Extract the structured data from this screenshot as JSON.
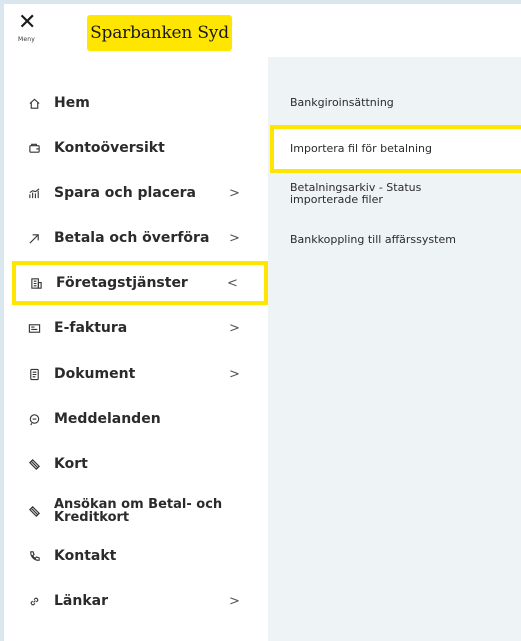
{
  "header": {
    "menu_label": "Meny",
    "brand": "Sparbanken Syd",
    "brand_color": "#ffe600"
  },
  "nav": {
    "items": [
      {
        "label": "Hem",
        "icon": "home-icon",
        "chevron": ""
      },
      {
        "label": "Kontoöversikt",
        "icon": "wallet-icon",
        "chevron": ""
      },
      {
        "label": "Spara och placera",
        "icon": "chart-icon",
        "chevron": ">"
      },
      {
        "label": "Betala och överföra",
        "icon": "transfer-icon",
        "chevron": ">"
      },
      {
        "label": "Företagstjänster",
        "icon": "building-icon",
        "chevron": "<"
      },
      {
        "label": "E-faktura",
        "icon": "invoice-icon",
        "chevron": ">"
      },
      {
        "label": "Dokument",
        "icon": "document-icon",
        "chevron": ">"
      },
      {
        "label": "Meddelanden",
        "icon": "message-icon",
        "chevron": ""
      },
      {
        "label": "Kort",
        "icon": "card-icon",
        "chevron": ""
      },
      {
        "label": "Ansökan om Betal- och Kreditkort",
        "icon": "card-icon",
        "chevron": ""
      },
      {
        "label": "Kontakt",
        "icon": "phone-icon",
        "chevron": ""
      },
      {
        "label": "Länkar",
        "icon": "link-icon",
        "chevron": ">"
      }
    ]
  },
  "submenu": {
    "items": [
      {
        "label": "Bankgiroinsättning"
      },
      {
        "label": "Importera fil för betalning"
      },
      {
        "label": "Betalningsarkiv - Status importerade filer"
      },
      {
        "label": "Bankkoppling till affärssystem"
      }
    ]
  }
}
